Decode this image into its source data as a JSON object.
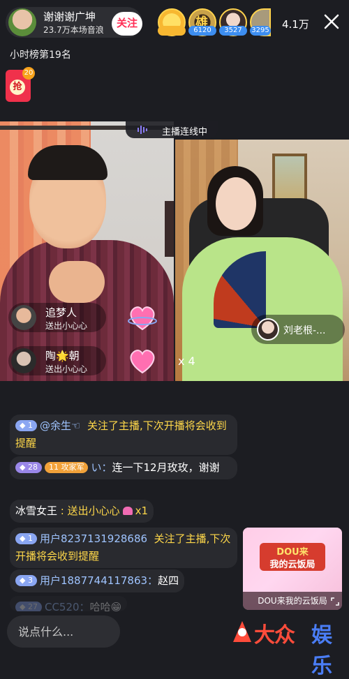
{
  "header": {
    "host_name": "谢谢谢广坤",
    "host_subtitle": "23.7万本场音浪",
    "follow_label": "关注",
    "viewers": [
      {
        "count": "",
        "color": "#f7b731"
      },
      {
        "count": "6120",
        "color": "#c8a14a"
      },
      {
        "count": "3527",
        "color": "#8e6cc0"
      },
      {
        "count": "3295",
        "color": "#a89a7b"
      }
    ],
    "viewer_brand_text": "雄",
    "online_count": "4.1万",
    "rank_text": "小时榜第19名"
  },
  "redpack": {
    "glyph": "抢",
    "badge": "20"
  },
  "connect": {
    "label": "主播连线中"
  },
  "gifts": [
    {
      "user": "追梦人",
      "desc": "送出小心心"
    },
    {
      "user": "陶🌟朝",
      "desc": "送出小心心"
    }
  ],
  "gift_multiplier": "x 4",
  "guest": {
    "name": "刘老根-..."
  },
  "chat": [
    {
      "level": "1",
      "user": "@余生☜",
      "text": "关注了主播,下次开播将会收到提醒"
    },
    {
      "level": "28",
      "fan_badge": "11 攻家军",
      "user": "い",
      "text": "连一下12月玫玫，谢谢"
    },
    {
      "user": "冰雪女王",
      "text": "送出小心心",
      "count": "x1"
    },
    {
      "level": "1",
      "user": "用户8237131928686",
      "text": "关注了主播,下次开播将会收到提醒"
    },
    {
      "level": "3",
      "user": "用户1887744117863",
      "text": "赵四"
    },
    {
      "level": "27",
      "user": "CC520",
      "text": "哈哈😁"
    }
  ],
  "promo": {
    "title_line1": "DOU来",
    "title_line2": "我的云饭局",
    "caption": "DOU来我的云饭局"
  },
  "input": {
    "placeholder": "说点什么..."
  },
  "watermark": {
    "text": "大众",
    "text2": "娱乐"
  },
  "colors": {
    "follow": "#ff2d55",
    "accent_blue": "#9fc4ff",
    "accent_yellow": "#ffd84a"
  }
}
